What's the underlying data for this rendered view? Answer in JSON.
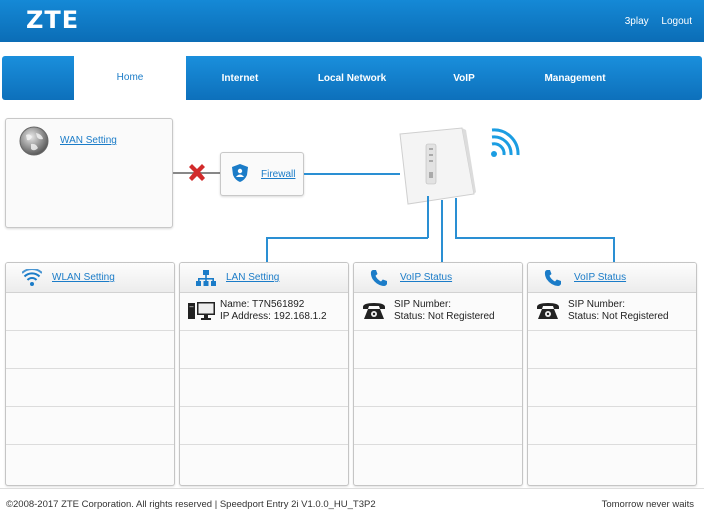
{
  "brand": {
    "logo": "ZTE"
  },
  "header": {
    "links": [
      "3play",
      "Logout"
    ]
  },
  "nav": {
    "tabs": [
      "Home",
      "Internet",
      "Local Network",
      "VoIP",
      "Management"
    ],
    "active": "Home"
  },
  "wan": {
    "label": "WAN Setting"
  },
  "firewall": {
    "label": "Firewall"
  },
  "wlan": {
    "label": "WLAN Setting"
  },
  "lan": {
    "label": "LAN Setting",
    "name": "Name: T7N561892",
    "ip": "IP Address: 192.168.1.2"
  },
  "voip1": {
    "label": "VoIP Status",
    "sip": "SIP Number:",
    "status": "Status: Not Registered"
  },
  "voip2": {
    "label": "VoIP Status",
    "sip": "SIP Number:",
    "status": "Status: Not Registered"
  },
  "footer": {
    "copyright": "©2008-2017 ZTE Corporation. All rights reserved  |   Speedport Entry 2i V1.0.0_HU_T3P2",
    "tagline": "Tomorrow never waits"
  },
  "colors": {
    "brand_blue": "#0b6db6",
    "link_blue": "#1b7cc8",
    "error_red": "#d22b2b"
  }
}
